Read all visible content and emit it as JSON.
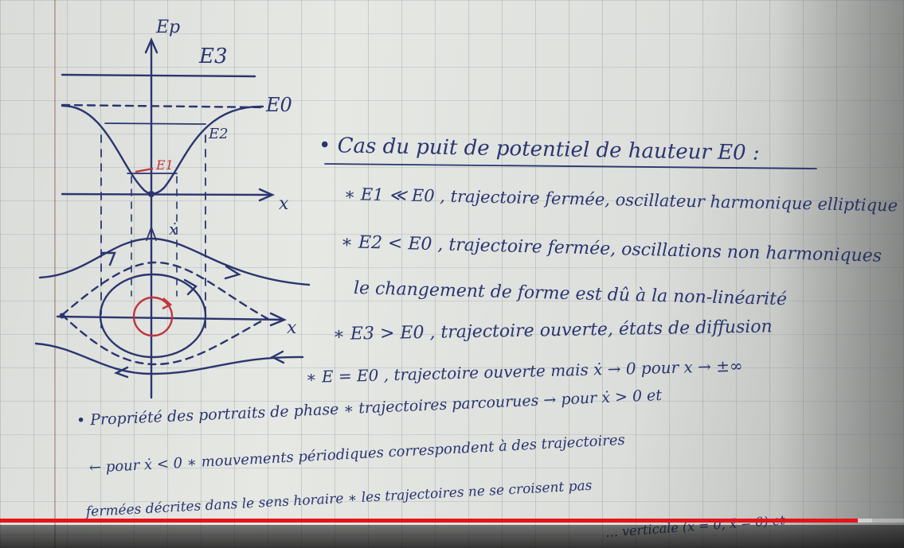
{
  "sketch": {
    "axis_labels": {
      "y_axis": "Ep",
      "x_axis_top": "x",
      "x_axis_bottom": "x",
      "velocity_axis": "ẋ"
    },
    "energy_labels": {
      "e3": "E3",
      "e0": "E0",
      "e2": "E2",
      "e1": "E1"
    }
  },
  "notes": [
    "• Cas du puit de potentiel de hauteur E0 :",
    "∗ E1 ≪ E0 , trajectoire fermée, oscillateur harmonique elliptique",
    "∗ E2 < E0 , trajectoire fermée, oscillations non harmoniques",
    "le changement de forme est dû à la non-linéarité",
    "∗ E3 > E0 , trajectoire ouverte, états de diffusion",
    "∗ E = E0 , trajectoire ouverte mais ẋ → 0 pour x → ±∞",
    "• Propriété des portraits de phase  ∗ trajectoires parcourues → pour ẋ > 0 et",
    "← pour ẋ < 0  ∗ mouvements périodiques correspondent à des trajectoires",
    "fermées décrites dans le sens horaire  ∗ les trajectoires ne se croisent pas",
    "… verticale (ẋ = 0, ẍ = 0) et"
  ],
  "video": {
    "progress": 0.949,
    "buffered": 0.965
  },
  "colors": {
    "ink": "#2a3570",
    "red_ink": "#c2343c",
    "progress": "#e5141a"
  }
}
